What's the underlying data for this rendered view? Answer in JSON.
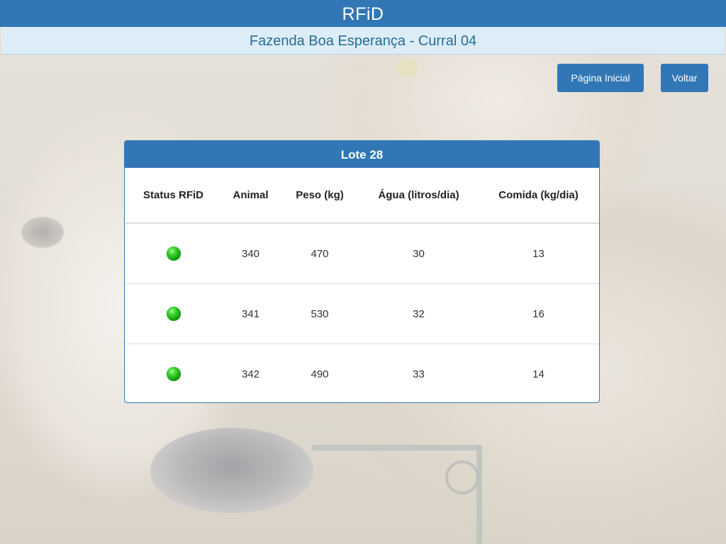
{
  "app": {
    "title": "RFiD"
  },
  "header": {
    "subtitle": "Fazenda Boa Esperança - Curral 04"
  },
  "nav": {
    "home_label": "Página Inicial",
    "back_label": "Voltar"
  },
  "panel": {
    "title": "Lote 28",
    "columns": [
      "Status RFiD",
      "Animal",
      "Peso (kg)",
      "Água (litros/dia)",
      "Comida (kg/dia)"
    ],
    "rows": [
      {
        "status": "active",
        "status_icon": "green-status-dot-icon",
        "animal": "340",
        "peso": "470",
        "agua": "30",
        "comida": "13"
      },
      {
        "status": "active",
        "status_icon": "green-status-dot-icon",
        "animal": "341",
        "peso": "530",
        "agua": "32",
        "comida": "16"
      },
      {
        "status": "active",
        "status_icon": "green-status-dot-icon",
        "animal": "342",
        "peso": "490",
        "agua": "33",
        "comida": "14"
      }
    ]
  },
  "colors": {
    "primary": "#3177b5",
    "subheader_bg": "#dcedf8",
    "subheader_text": "#286b95",
    "status_ok": "#22b322"
  }
}
